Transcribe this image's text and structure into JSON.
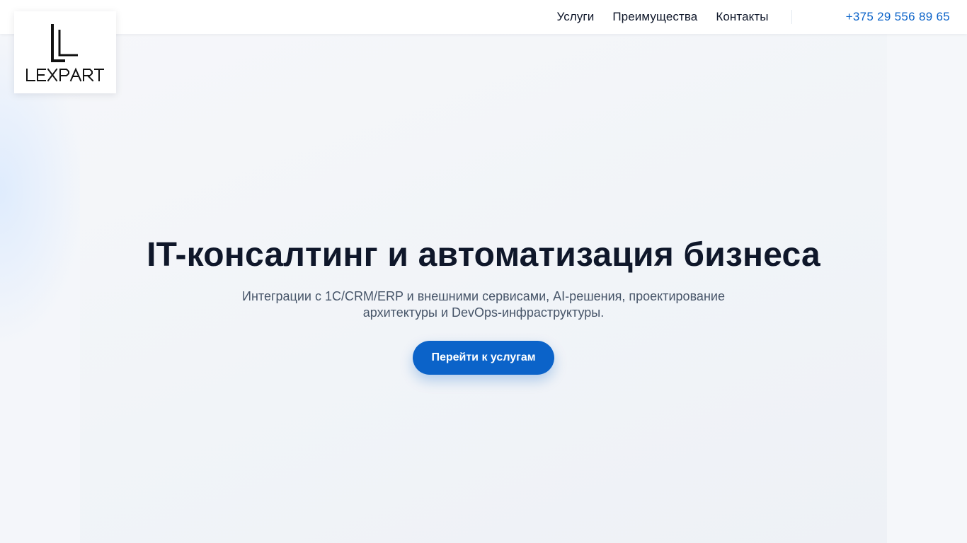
{
  "header": {
    "logo_text": "LEXPART",
    "nav": [
      {
        "label": "Услуги"
      },
      {
        "label": "Преимущества"
      },
      {
        "label": "Контакты"
      }
    ],
    "phone": "+375 29 556 89 65"
  },
  "hero": {
    "title": "IT-консалтинг и автоматизация бизнеса",
    "subtitle": "Интеграции с 1С/CRM/ERP и внешними сервисами, AI-решения, проектирование архитектуры и DevOps-инфраструктуры.",
    "cta_label": "Перейти к услугам"
  },
  "colors": {
    "accent": "#0b63c9",
    "text_dark": "#0f172a",
    "text_muted": "#475569"
  }
}
